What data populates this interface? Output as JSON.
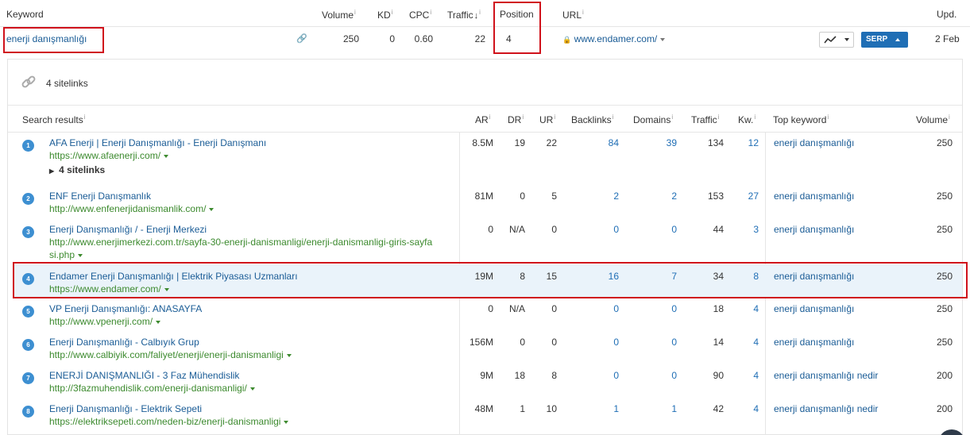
{
  "header": {
    "keyword": "Keyword",
    "volume": "Volume",
    "kd": "KD",
    "cpc": "CPC",
    "traffic": "Traffic",
    "position": "Position",
    "url": "URL",
    "upd": "Upd."
  },
  "keyword_row": {
    "keyword": "enerji danışmanlığı",
    "volume": "250",
    "kd": "0",
    "cpc": "0.60",
    "traffic": "22",
    "position": "4",
    "url": "www.endamer.com/",
    "serp_label": "SERP",
    "updated": "2 Feb"
  },
  "sitelinks_summary": "4 sitelinks",
  "table_header": {
    "search_results": "Search results",
    "ar": "AR",
    "dr": "DR",
    "ur": "UR",
    "backlinks": "Backlinks",
    "domains": "Domains",
    "traffic": "Traffic",
    "kw": "Kw.",
    "top_keyword": "Top keyword",
    "volume": "Volume"
  },
  "results": [
    {
      "rank": "1",
      "title": "AFA Enerji | Enerji Danışmanlığı - Enerji Danışmanı",
      "url": "https://www.afaenerji.com/",
      "url2": "",
      "sitelinks": "4 sitelinks",
      "ar": "8.5M",
      "dr": "19",
      "ur": "22",
      "backlinks": "84",
      "domains": "39",
      "traffic": "134",
      "kw": "12",
      "top_keyword": "enerji danışmanlığı",
      "volume": "250"
    },
    {
      "rank": "2",
      "title": "ENF Enerji Danışmanlık",
      "url": "http://www.enfenerjidanismanlik.com/",
      "url2": "",
      "sitelinks": "",
      "ar": "81M",
      "dr": "0",
      "ur": "5",
      "backlinks": "2",
      "domains": "2",
      "traffic": "153",
      "kw": "27",
      "top_keyword": "enerji danışmanlığı",
      "volume": "250"
    },
    {
      "rank": "3",
      "title": "Enerji Danışmanlığı / - Enerji Merkezi",
      "url": "http://www.enerjimerkezi.com.tr/sayfa-30-enerji-danismanligi/enerji-danismanligi-giris-sayfa",
      "url2": "si.php",
      "sitelinks": "",
      "ar": "0",
      "dr": "N/A",
      "ur": "0",
      "backlinks": "0",
      "domains": "0",
      "traffic": "44",
      "kw": "3",
      "top_keyword": "enerji danışmanlığı",
      "volume": "250"
    },
    {
      "rank": "4",
      "title": "Endamer Enerji Danışmanlığı | Elektrik Piyasası Uzmanları",
      "url": "https://www.endamer.com/",
      "url2": "",
      "sitelinks": "",
      "ar": "19M",
      "dr": "8",
      "ur": "15",
      "backlinks": "16",
      "domains": "7",
      "traffic": "34",
      "kw": "8",
      "top_keyword": "enerji danışmanlığı",
      "volume": "250"
    },
    {
      "rank": "5",
      "title": "VP Enerji Danışmanlığı: ANASAYFA",
      "url": "http://www.vpenerji.com/",
      "url2": "",
      "sitelinks": "",
      "ar": "0",
      "dr": "N/A",
      "ur": "0",
      "backlinks": "0",
      "domains": "0",
      "traffic": "18",
      "kw": "4",
      "top_keyword": "enerji danışmanlığı",
      "volume": "250"
    },
    {
      "rank": "6",
      "title": "Enerji Danışmanlığı - Calbıyık Grup",
      "url": "http://www.calbiyik.com/faliyet/enerji/enerji-danismanligi",
      "url2": "",
      "sitelinks": "",
      "ar": "156M",
      "dr": "0",
      "ur": "0",
      "backlinks": "0",
      "domains": "0",
      "traffic": "14",
      "kw": "4",
      "top_keyword": "enerji danışmanlığı",
      "volume": "250"
    },
    {
      "rank": "7",
      "title": "ENERJİ DANIŞMANLIĞI - 3 Faz Mühendislik",
      "url": "http://3fazmuhendislik.com/enerji-danismanligi/",
      "url2": "",
      "sitelinks": "",
      "ar": "9M",
      "dr": "18",
      "ur": "8",
      "backlinks": "0",
      "domains": "0",
      "traffic": "90",
      "kw": "4",
      "top_keyword": "enerji danışmanlığı nedir",
      "volume": "200"
    },
    {
      "rank": "8",
      "title": "Enerji Danışmanlığı - Elektrik Sepeti",
      "url": "https://elektriksepeti.com/neden-biz/enerji-danismanligi",
      "url2": "",
      "sitelinks": "",
      "ar": "48M",
      "dr": "1",
      "ur": "10",
      "backlinks": "1",
      "domains": "1",
      "traffic": "42",
      "kw": "4",
      "top_keyword": "enerji danışmanlığı nedir",
      "volume": "200"
    }
  ],
  "colors": {
    "link": "#1a5c96",
    "url_green": "#3c8a2e",
    "badge": "#3d8fd1",
    "serp_button": "#1f6eb5",
    "highlight_row": "#eaf3fa",
    "annotation_red": "#d0121b"
  }
}
